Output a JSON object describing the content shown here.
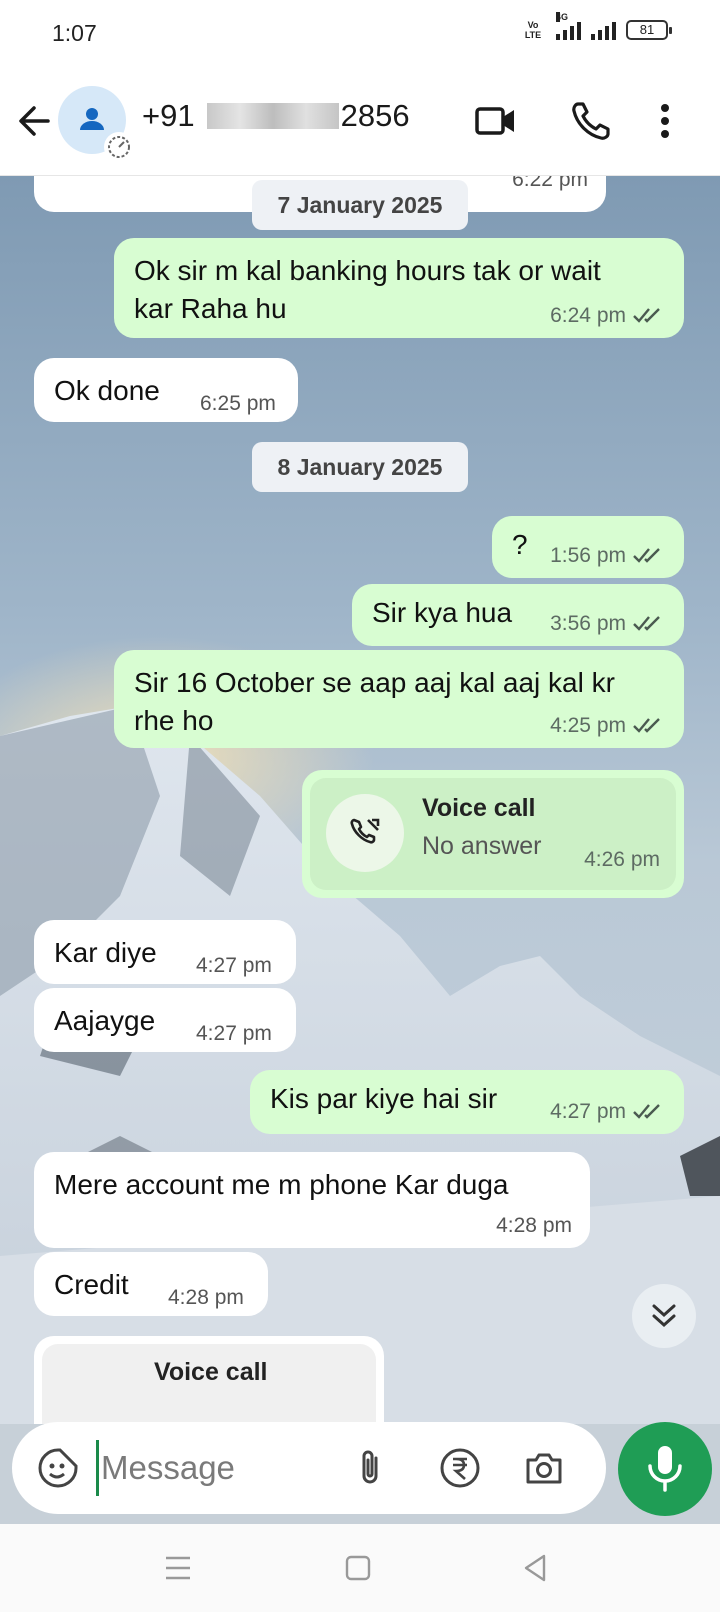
{
  "status": {
    "time": "1:07",
    "volte": "Vo LTE",
    "network": "4G",
    "battery": "81"
  },
  "header": {
    "phone_prefix": "+91",
    "phone_suffix": "2856"
  },
  "messages": [
    {
      "type": "date",
      "text": "7 January 2025",
      "partial_time": "6:22 pm"
    },
    {
      "type": "out",
      "text": "Ok sir m kal banking hours tak or wait kar Raha hu",
      "time": "6:24 pm"
    },
    {
      "type": "in",
      "text": "Ok done",
      "time": "6:25 pm"
    },
    {
      "type": "date",
      "text": "8 January 2025"
    },
    {
      "type": "out",
      "text": "?",
      "time": "1:56 pm"
    },
    {
      "type": "out",
      "text": "Sir kya hua",
      "time": "3:56 pm"
    },
    {
      "type": "out",
      "text": "Sir 16 October se aap aaj kal aaj kal kr rhe ho",
      "time": "4:25 pm"
    },
    {
      "type": "call",
      "title": "Voice call",
      "status": "No answer",
      "time": "4:26 pm"
    },
    {
      "type": "in",
      "text": "Kar diye",
      "time": "4:27 pm"
    },
    {
      "type": "in",
      "text": "Aajayge",
      "time": "4:27 pm"
    },
    {
      "type": "out",
      "text": "Kis par kiye hai sir",
      "time": "4:27 pm"
    },
    {
      "type": "in",
      "text": "Mere account me m phone Kar duga",
      "time": "4:28 pm"
    },
    {
      "type": "in",
      "text": "Credit",
      "time": "4:28 pm"
    },
    {
      "type": "call_partial",
      "title": "Voice call"
    }
  ],
  "composer": {
    "placeholder": "Message"
  },
  "colors": {
    "outgoing": "#d8fdd2",
    "incoming": "#ffffff",
    "accent": "#1f9d55"
  }
}
